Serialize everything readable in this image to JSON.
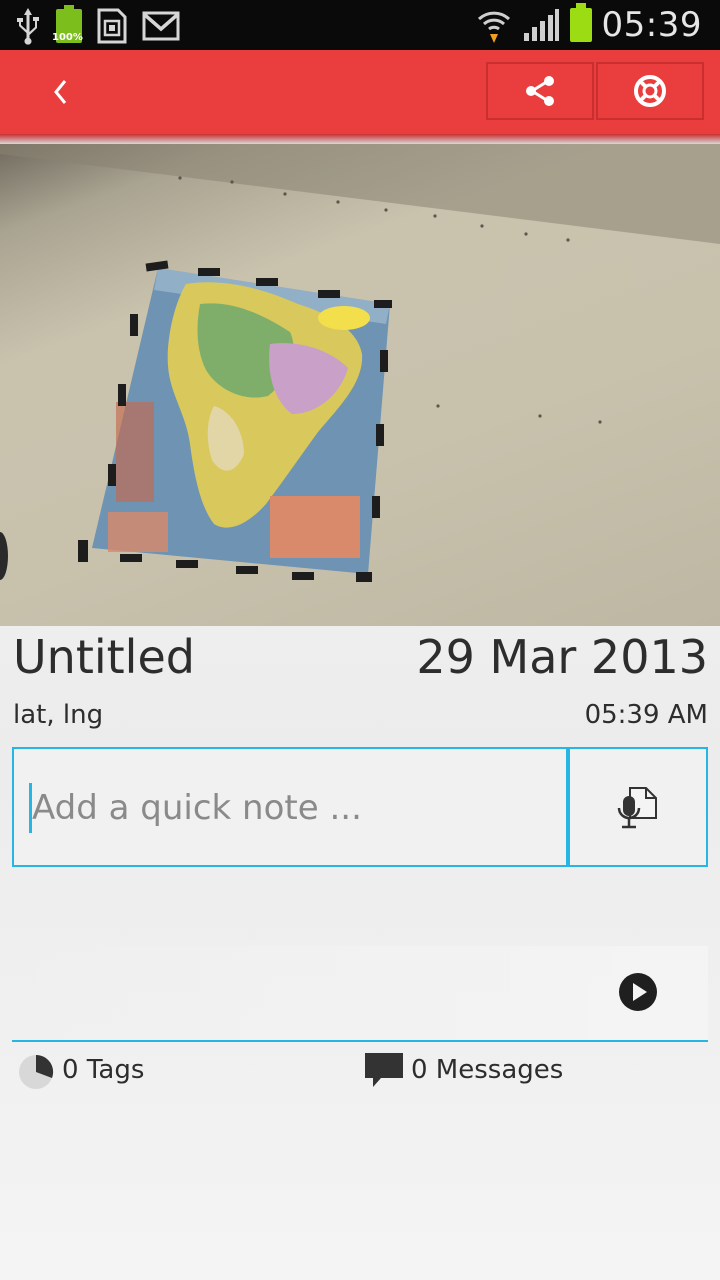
{
  "status_bar": {
    "time": "05:39",
    "battery_small_label": "100%",
    "icons": [
      "usb-icon",
      "battery-icon",
      "sd-card-icon",
      "gmail-icon",
      "wifi-icon",
      "signal-icon",
      "battery-full-icon"
    ]
  },
  "action_bar": {
    "background": "#ea3d3d",
    "back_icon": "chevron-left-icon",
    "share_icon": "share-icon",
    "help_icon": "lifebuoy-icon"
  },
  "note": {
    "title": "Untitled",
    "date": "29 Mar 2013",
    "location": "lat, lng",
    "time": "05:39 AM"
  },
  "quick_note": {
    "placeholder": "Add a quick note ...",
    "value": "",
    "voice_icon": "mic-note-icon"
  },
  "audio": {
    "play_icon": "play-icon"
  },
  "meta": {
    "tags_label": "0 Tags",
    "messages_label": "0 Messages"
  },
  "colors": {
    "accent": "#27b5e3",
    "text": "#2d2d2d"
  }
}
